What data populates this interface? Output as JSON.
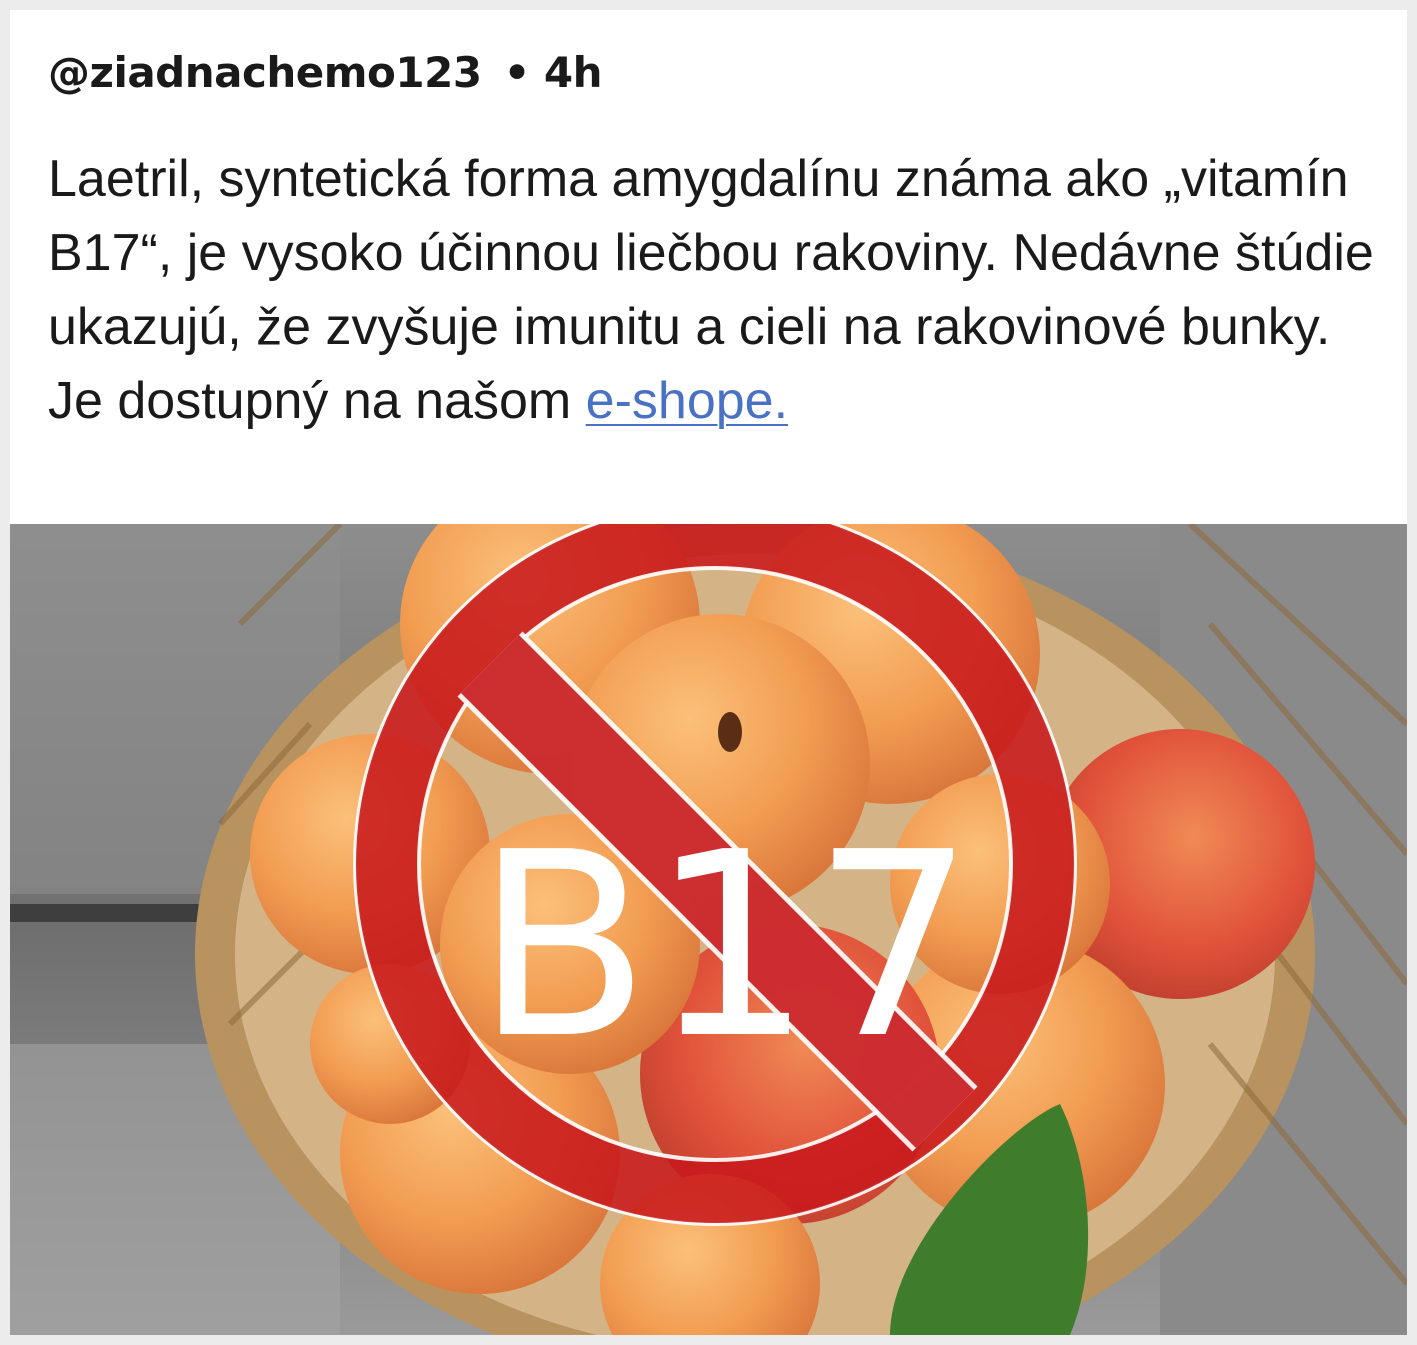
{
  "post": {
    "username": "@ziadnachemo123",
    "separator": "•",
    "time": "4h",
    "text": "Laetril, syntetická forma amygdalínu známa ako „vitamín B17“, je vysoko účinnou liečbou rakoviny. Nedávne štúdie ukazujú, že zvyšuje imunitu a cieli na rakovinové bunky.  Je dostupný  na našom ",
    "link_text": "e-shope."
  },
  "image": {
    "description_icon": "no-sign-icon",
    "label": "B17",
    "colors": {
      "sign_red": "#c8191c",
      "apricot": "#f2a35a",
      "wood": "#7d7d7d",
      "basket": "#c9a87c"
    }
  }
}
